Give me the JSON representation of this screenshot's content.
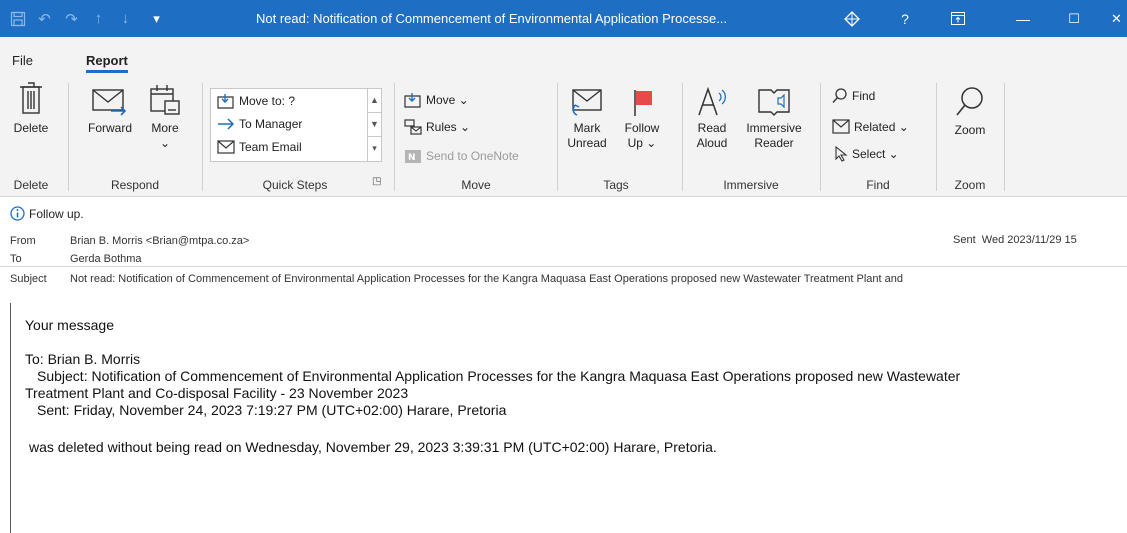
{
  "titlebar": {
    "title": "Not read: Notification of Commencement of Environmental Application Processe...",
    "help": "?",
    "minimize": "—",
    "maximize": "☐",
    "close": "✕"
  },
  "tabs": [
    {
      "label": "File"
    },
    {
      "label": "Report"
    }
  ],
  "ribbon": {
    "delete": {
      "button": "Delete",
      "group": "Delete"
    },
    "respond": {
      "forward": "Forward",
      "more": "More",
      "more_caret": "⌄",
      "group": "Respond"
    },
    "quick_steps": {
      "items": [
        "Move to: ?",
        "To Manager",
        "Team Email"
      ],
      "group": "Quick Steps"
    },
    "move": {
      "move": "Move ⌄",
      "rules": "Rules ⌄",
      "onenote": "Send to OneNote",
      "group": "Move"
    },
    "tags": {
      "mark_unread_1": "Mark",
      "mark_unread_2": "Unread",
      "follow_up_1": "Follow",
      "follow_up_2": "Up ⌄",
      "group": "Tags"
    },
    "immersive": {
      "read_aloud_1": "Read",
      "read_aloud_2": "Aloud",
      "immersive_reader_1": "Immersive",
      "immersive_reader_2": "Reader",
      "group": "Immersive"
    },
    "find": {
      "find": "Find",
      "related": "Related ⌄",
      "select": "Select ⌄",
      "group": "Find"
    },
    "zoom": {
      "zoom": "Zoom",
      "group": "Zoom"
    }
  },
  "message": {
    "followup": "Follow up.",
    "from_label": "From",
    "from": "Brian B. Morris <Brian@mtpa.co.za>",
    "to_label": "To",
    "to": "Gerda Bothma",
    "subject_label": "Subject",
    "subject": "Not read: Notification of Commencement of Environmental Application Processes for the Kangra Maquasa East Operations proposed new Wastewater Treatment Plant and",
    "sent_label": "Sent",
    "sent": "Wed 2023/11/29 15"
  },
  "body": {
    "line1": "Your message",
    "to_line": "To: Brian B. Morris",
    "subject_line_1": "Subject: Notification of Commencement of Environmental Application Processes for the Kangra Maquasa East Operations proposed new Wastewater",
    "subject_line_2": "Treatment Plant and Co-disposal Facility - 23 November 2023",
    "sent_line": "Sent: Friday, November 24, 2023 7:19:27 PM (UTC+02:00) Harare, Pretoria",
    "deleted_line": "was deleted without being read on Wednesday, November 29, 2023 3:39:31 PM (UTC+02:00) Harare, Pretoria."
  }
}
